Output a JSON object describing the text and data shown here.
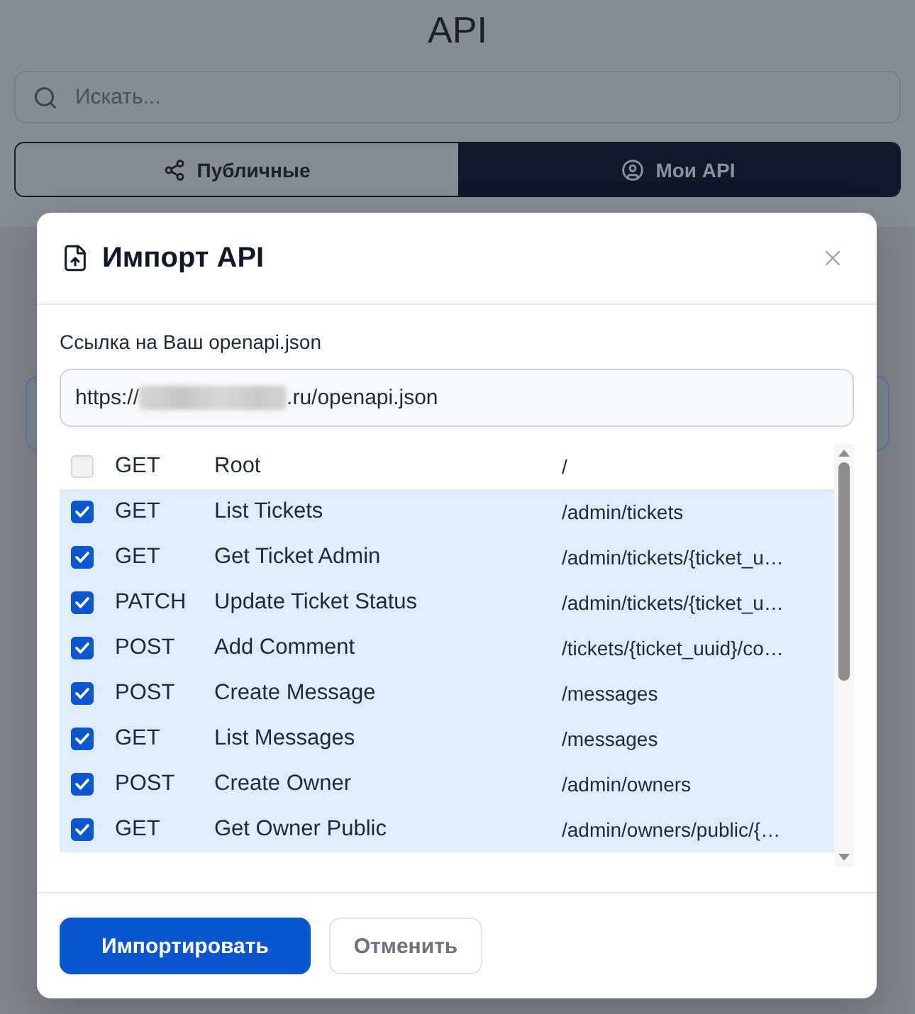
{
  "page_title": "API",
  "search": {
    "placeholder": "Искать..."
  },
  "tabs": [
    {
      "label": "Публичные",
      "selected": false
    },
    {
      "label": "Мои API",
      "selected": true
    }
  ],
  "dialog": {
    "title": "Импорт API",
    "url_label": "Ссылка на Ваш openapi.json",
    "url_field": {
      "value_start": "https://",
      "redacted": true,
      "value_end": ".ru/openapi.json"
    },
    "endpoints": [
      {
        "method": "GET",
        "name": "Root",
        "path": "/",
        "checked": false
      },
      {
        "method": "GET",
        "name": "List Tickets",
        "path": "/admin/tickets",
        "checked": true
      },
      {
        "method": "GET",
        "name": "Get Ticket Admin",
        "path": "/admin/tickets/{ticket_u…",
        "checked": true
      },
      {
        "method": "PATCH",
        "name": "Update Ticket Status",
        "path": "/admin/tickets/{ticket_u…",
        "checked": true
      },
      {
        "method": "POST",
        "name": "Add Comment",
        "path": "/tickets/{ticket_uuid}/co…",
        "checked": true
      },
      {
        "method": "POST",
        "name": "Create Message",
        "path": "/messages",
        "checked": true
      },
      {
        "method": "GET",
        "name": "List Messages",
        "path": "/messages",
        "checked": true
      },
      {
        "method": "POST",
        "name": "Create Owner",
        "path": "/admin/owners",
        "checked": true
      },
      {
        "method": "GET",
        "name": "Get Owner Public",
        "path": "/admin/owners/public/{…",
        "checked": true
      }
    ],
    "buttons": [
      {
        "label": "Импортировать",
        "kind": "primary"
      },
      {
        "label": "Отменить",
        "kind": "secondary"
      }
    ]
  }
}
